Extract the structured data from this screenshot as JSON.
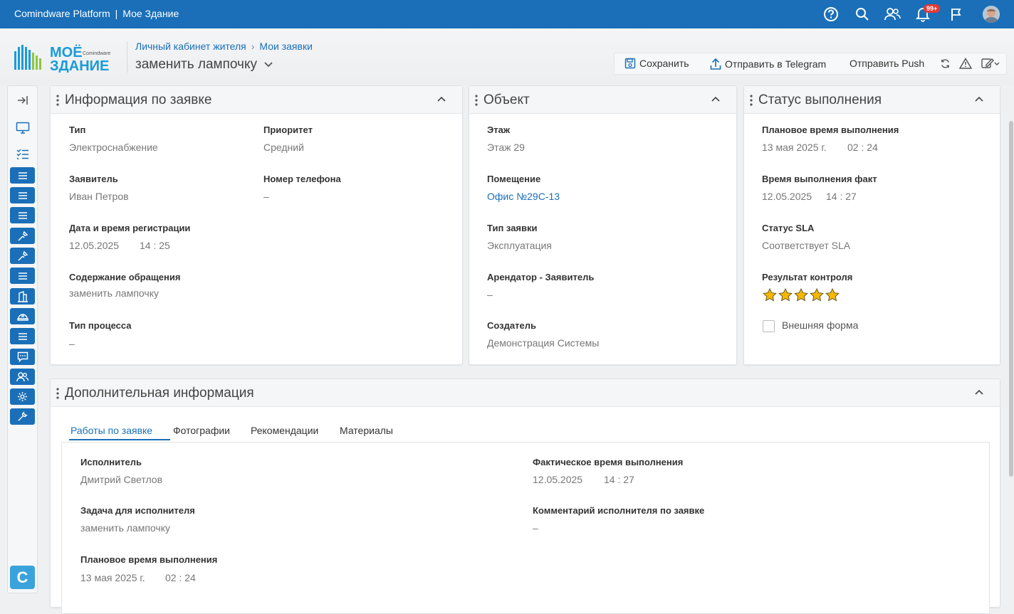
{
  "app": {
    "platform": "Comindware Platform",
    "section": "Мое Здание"
  },
  "topbar": {
    "notification_badge": "99+"
  },
  "logo": {
    "line1": "МОЁ",
    "line2": "ЗДАНИЕ",
    "brand": "Comindware"
  },
  "breadcrumbs": [
    "Личный кабинет жителя",
    "Мои заявки"
  ],
  "page_title": "заменить лампочку",
  "toolbar": {
    "save": "Сохранить",
    "telegram": "Отправить в Telegram",
    "push": "Отправить Push"
  },
  "request_info": {
    "title": "Информация по заявке",
    "type_label": "Тип",
    "type_value": "Электроснабжение",
    "priority_label": "Приоритет",
    "priority_value": "Средний",
    "applicant_label": "Заявитель",
    "applicant_value": "Иван Петров",
    "phone_label": "Номер телефона",
    "phone_value": "–",
    "reg_label": "Дата и время регистрации",
    "reg_date": "12.05.2025",
    "reg_time": "14 : 25",
    "content_label": "Содержание обращения",
    "content_value": "заменить лампочку",
    "process_label": "Тип процесса",
    "process_value": "–"
  },
  "object": {
    "title": "Объект",
    "floor_label": "Этаж",
    "floor_value": "Этаж 29",
    "room_label": "Помещение",
    "room_value": "Офис №29С-13",
    "req_type_label": "Тип заявки",
    "req_type_value": "Эксплуатация",
    "tenant_label": "Арендатор - Заявитель",
    "tenant_value": "–",
    "creator_label": "Создатель",
    "creator_value": "Демонстрация Системы"
  },
  "status": {
    "title": "Статус выполнения",
    "planned_label": "Плановое время выполнения",
    "planned_date": "13 мая 2025 г.",
    "planned_time": "02 : 24",
    "actual_label": "Время выполнения факт",
    "actual_date": "12.05.2025",
    "actual_time": "14 : 27",
    "sla_label": "Статус SLA",
    "sla_value": "Соответствует SLA",
    "control_label": "Результат контроля",
    "rating": 5,
    "rating_max": 5,
    "external_form_label": "Внешняя форма",
    "external_form_checked": false
  },
  "additional": {
    "title": "Дополнительная информация",
    "tabs": [
      "Работы по заявке",
      "Фотографии",
      "Рекомендации",
      "Материалы"
    ],
    "active_tab": 0,
    "executor_label": "Исполнитель",
    "executor_value": "Дмитрий Светлов",
    "task_label": "Задача для исполнителя",
    "task_value": "заменить лампочку",
    "planned_label": "Плановое время выполнения",
    "planned_date": "13 мая 2025 г.",
    "planned_time": "02 : 24",
    "actual_label": "Фактическое время выполнения",
    "actual_date": "12.05.2025",
    "actual_time": "14 : 27",
    "comment_label": "Комментарий исполнителя по заявке",
    "comment_value": "–"
  },
  "colors": {
    "primary": "#1a6fb8",
    "star": "#f5b800"
  }
}
